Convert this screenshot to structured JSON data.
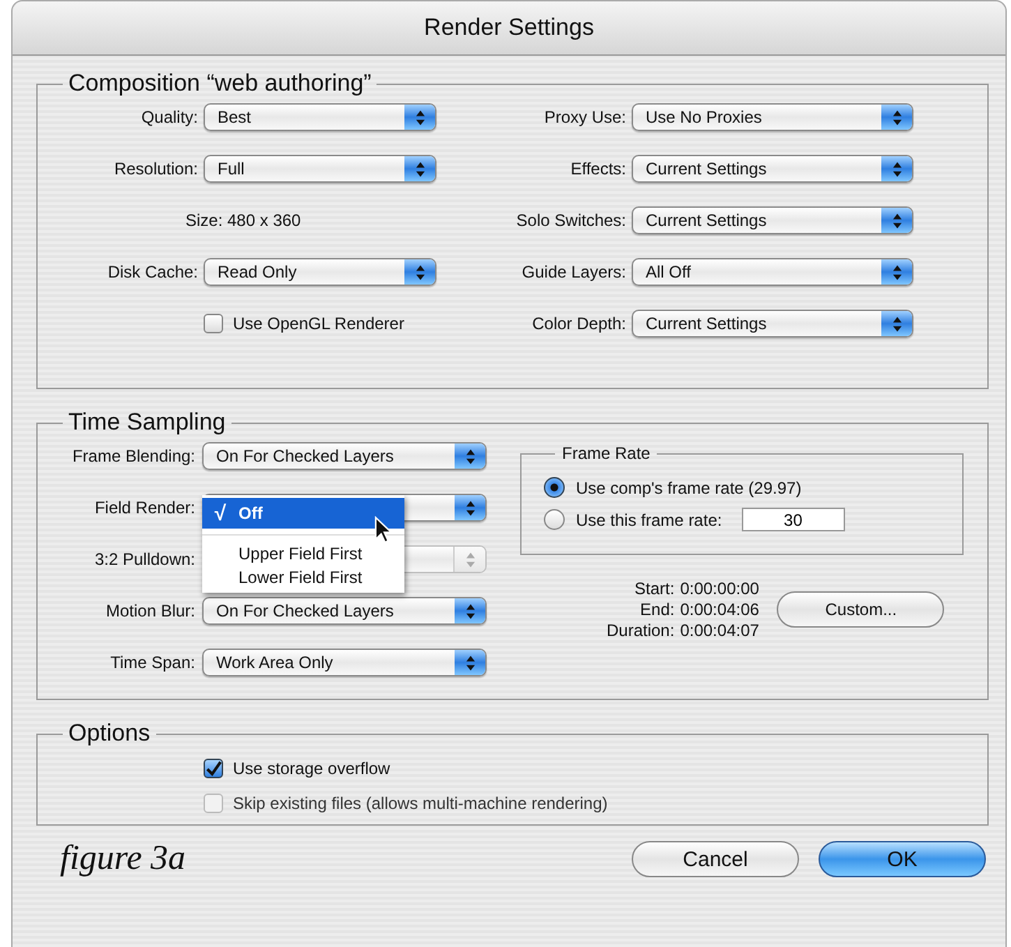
{
  "window": {
    "title": "Render Settings"
  },
  "composition": {
    "title": "Composition “web authoring”",
    "left": [
      {
        "kind": "popup",
        "label": "Quality:",
        "value": "Best"
      },
      {
        "kind": "popup",
        "label": "Resolution:",
        "value": "Full"
      },
      {
        "kind": "info",
        "text": "Size: 480 x 360"
      },
      {
        "kind": "popup",
        "label": "Disk Cache:",
        "value": "Read Only"
      },
      {
        "kind": "checkbox",
        "label": "Use OpenGL Renderer",
        "checked": false
      }
    ],
    "right": [
      {
        "label": "Proxy Use:",
        "value": "Use No Proxies"
      },
      {
        "label": "Effects:",
        "value": "Current Settings"
      },
      {
        "label": "Solo Switches:",
        "value": "Current Settings"
      },
      {
        "label": "Guide Layers:",
        "value": "All Off"
      },
      {
        "label": "Color Depth:",
        "value": "Current Settings"
      }
    ]
  },
  "time_sampling": {
    "title": "Time Sampling",
    "rows": [
      {
        "label": "Frame Blending:",
        "value": "On For Checked Layers",
        "disabled": false
      },
      {
        "label": "Field Render:",
        "disabled": false,
        "open": true
      },
      {
        "label": "3:2 Pulldown:",
        "disabled": true
      },
      {
        "label": "Motion Blur:",
        "value": "On For Checked Layers",
        "disabled": false
      },
      {
        "label": "Time Span:",
        "value": "Work Area Only",
        "disabled": false
      }
    ],
    "menu": [
      {
        "kind": "item",
        "mark": "√",
        "label": "Off",
        "selected": true
      },
      {
        "kind": "separator"
      },
      {
        "kind": "item",
        "label": "Upper Field First",
        "selected": false
      },
      {
        "kind": "item",
        "label": "Lower Field First",
        "selected": false
      }
    ],
    "frame_rate": {
      "title": "Frame Rate",
      "options": [
        {
          "label": "Use comp's frame rate (29.97)",
          "selected": true
        },
        {
          "label": "Use this frame rate:",
          "selected": false,
          "value": "30"
        }
      ]
    },
    "times": [
      {
        "label": "Start:",
        "value": "0:00:00:00"
      },
      {
        "label": "End:",
        "value": "0:00:04:06"
      },
      {
        "label": "Duration:",
        "value": "0:00:04:07"
      }
    ],
    "custom_button": "Custom..."
  },
  "options": {
    "title": "Options",
    "checkboxes": [
      {
        "label": "Use storage overflow",
        "checked": true,
        "disabled": false
      },
      {
        "label": "Skip existing files (allows multi-machine rendering)",
        "checked": false,
        "disabled": true
      }
    ]
  },
  "caption": "figure 3a",
  "buttons": [
    {
      "label": "Cancel",
      "default": false
    },
    {
      "label": "OK",
      "default": true
    }
  ]
}
